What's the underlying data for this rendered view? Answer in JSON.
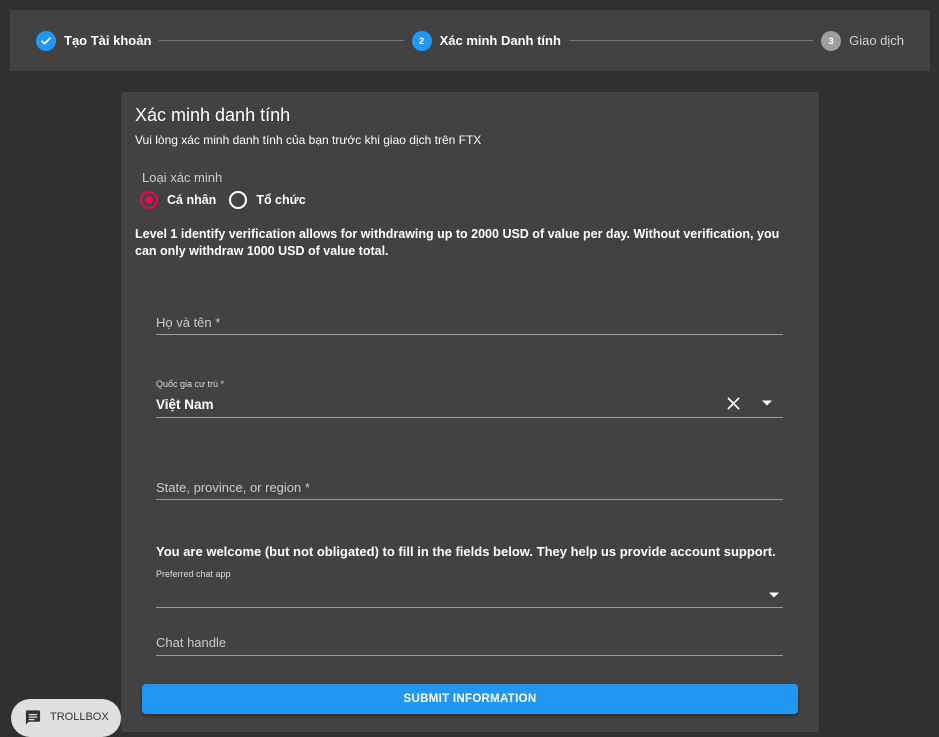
{
  "stepper": {
    "steps": [
      {
        "number": "1",
        "label": "Tạo Tài khoản",
        "state": "done"
      },
      {
        "number": "2",
        "label": "Xác minh Danh tính",
        "state": "active"
      },
      {
        "number": "3",
        "label": "Giao dịch",
        "state": "pending"
      }
    ]
  },
  "card": {
    "title": "Xác minh danh tính",
    "subtitle": "Vui lòng xác minh danh tính của bạn trước khi giao dịch trên FTX",
    "verification_type": {
      "legend": "Loại xác minh",
      "options": [
        {
          "label": "Cá nhân",
          "checked": true
        },
        {
          "label": "Tổ chức",
          "checked": false
        }
      ]
    },
    "info_text": "Level 1 identify verification allows for withdrawing up to 2000 USD of value per day. Without verification, you can only withdraw 1000 USD of value total.",
    "fields": {
      "full_name": {
        "placeholder": "Họ và tên *",
        "value": ""
      },
      "country": {
        "label": "Quốc gia cư trú *",
        "value": "Việt Nam"
      },
      "state": {
        "placeholder": "State, province, or region *",
        "value": ""
      },
      "chat_app": {
        "label": "Preferred chat app",
        "value": ""
      },
      "chat_handle": {
        "placeholder": "Chat handle",
        "value": ""
      }
    },
    "optional_notice": "You are welcome (but not obligated) to fill in the fields below. They help us provide account support.",
    "submit_label": "SUBMIT INFORMATION"
  },
  "trollbox": {
    "label": "TROLLBOX"
  },
  "colors": {
    "background": "#303030",
    "panel": "#424242",
    "accent": "#2196f3",
    "radio_selected": "#f50057",
    "step_pending": "#9e9e9e"
  },
  "icons": [
    "check-icon",
    "clear-icon",
    "dropdown-arrow-icon",
    "chat-icon"
  ]
}
